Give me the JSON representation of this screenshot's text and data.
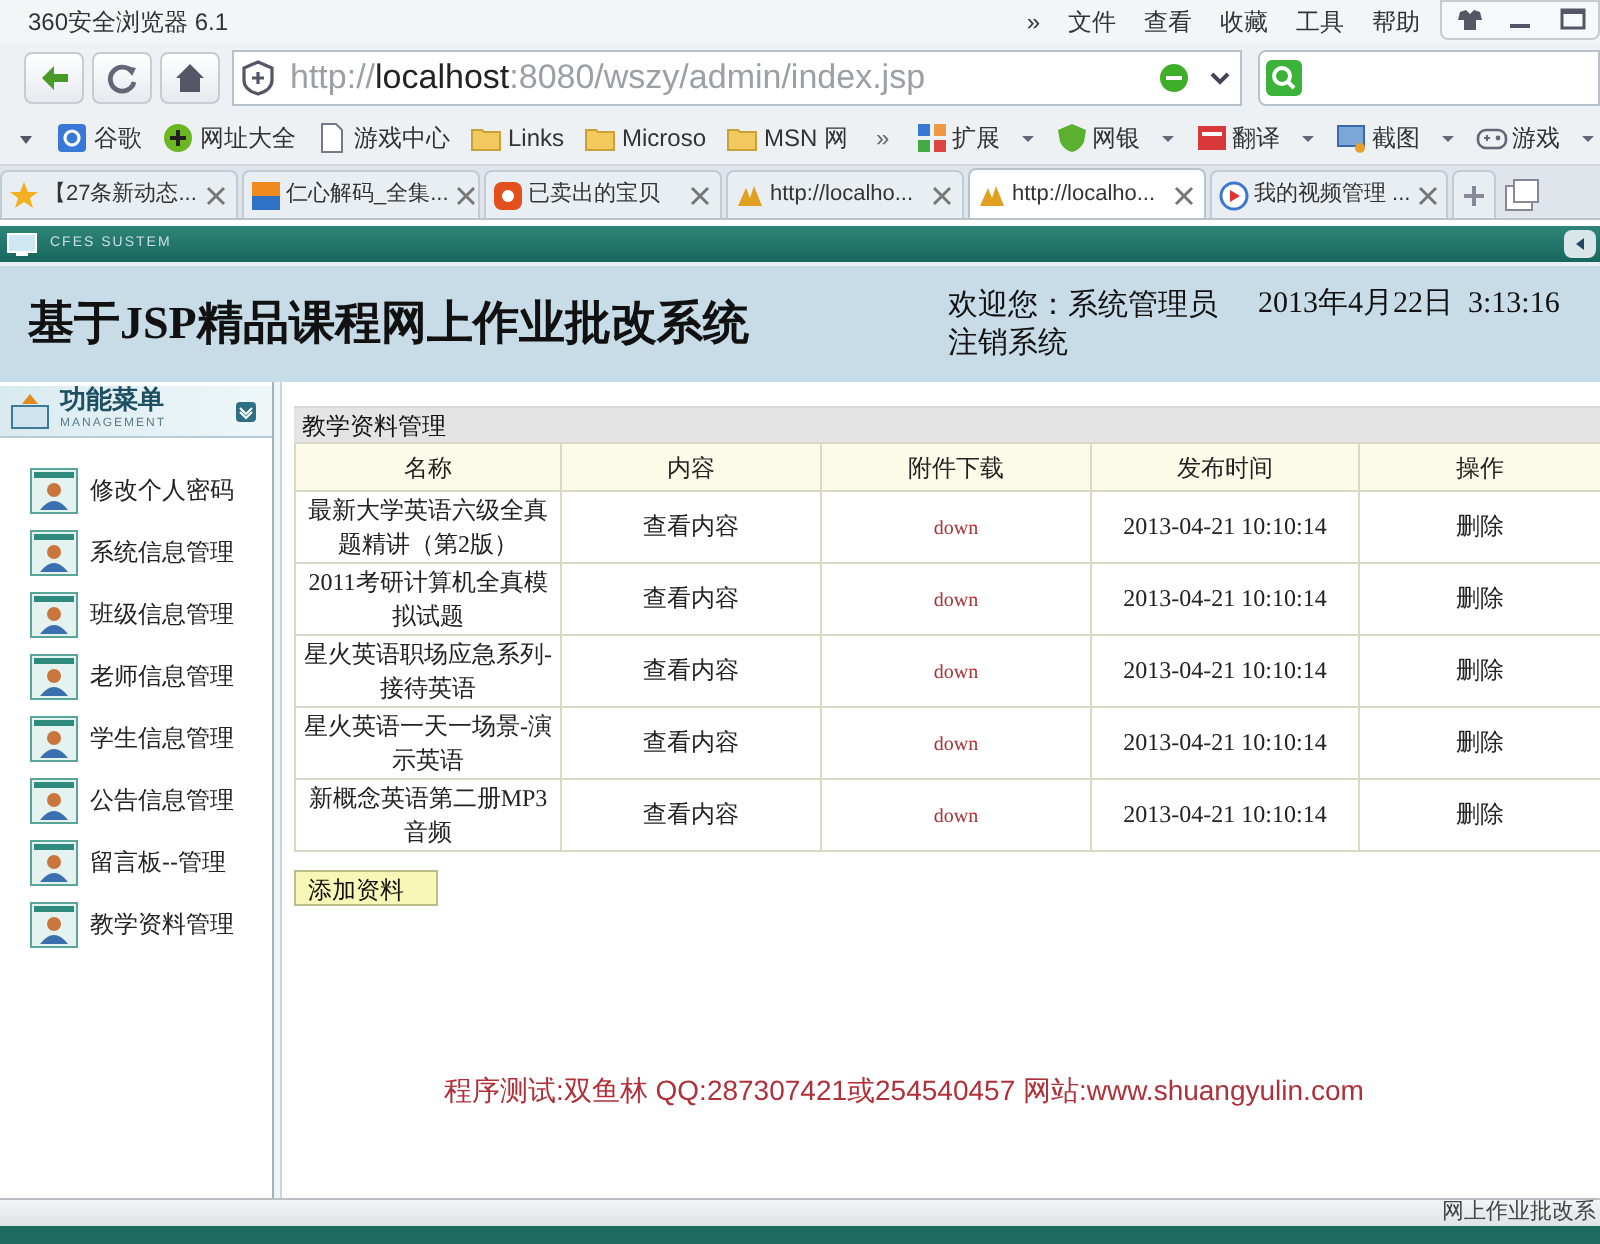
{
  "browser": {
    "title": "360安全浏览器 6.1",
    "menu": [
      "»",
      "文件",
      "查看",
      "收藏",
      "工具",
      "帮助"
    ],
    "url_parts": [
      "http://",
      "localhost",
      ":8080/wszy/admin/index.jsp"
    ],
    "bookmarks": [
      {
        "label": "谷歌",
        "kind": "google"
      },
      {
        "label": "网址大全",
        "kind": "plus"
      },
      {
        "label": "游戏中心",
        "kind": "page"
      },
      {
        "label": "Links",
        "kind": "folder"
      },
      {
        "label": "Microso",
        "kind": "folder"
      },
      {
        "label": "MSN 网",
        "kind": "folder"
      }
    ],
    "more": "»",
    "tools": [
      {
        "label": "扩展",
        "kind": "grid"
      },
      {
        "label": "网银",
        "kind": "shield"
      },
      {
        "label": "翻译",
        "kind": "dictionary"
      },
      {
        "label": "截图",
        "kind": "screen"
      },
      {
        "label": "游戏",
        "kind": "gamepad"
      }
    ],
    "tabs": [
      {
        "label": "【27条新动态...",
        "kind": "star",
        "selected": false
      },
      {
        "label": "仁心解码_全集...",
        "kind": "soku",
        "selected": false
      },
      {
        "label": "已卖出的宝贝",
        "kind": "shop",
        "selected": false
      },
      {
        "label": "http://localho...",
        "kind": "pma",
        "selected": false
      },
      {
        "label": "http://localho...",
        "kind": "pma",
        "selected": true
      },
      {
        "label": "我的视频管理 ...",
        "kind": "play",
        "selected": false
      }
    ]
  },
  "app": {
    "brand": "CFES SUSTEM",
    "title": "基于JSP精品课程网上作业批改系统",
    "welcome": "欢迎您：系统管理员",
    "datetime": "2013年4月22日  3:13:16",
    "logout": "注销系统"
  },
  "sidebar": {
    "title": "功能菜单",
    "subtitle": "MANAGEMENT",
    "items": [
      "修改个人密码",
      "系统信息管理",
      "班级信息管理",
      "老师信息管理",
      "学生信息管理",
      "公告信息管理",
      "留言板--管理",
      "教学资料管理"
    ]
  },
  "panel": {
    "title": "教学资料管理",
    "columns": [
      "名称",
      "内容",
      "附件下载",
      "发布时间",
      "操作"
    ],
    "rows": [
      [
        "最新大学英语六级全真题精讲（第2版）",
        "查看内容",
        "down",
        "2013-04-21 10:10:14",
        "删除"
      ],
      [
        "2011考研计算机全真模拟试题",
        "查看内容",
        "down",
        "2013-04-21 10:10:14",
        "删除"
      ],
      [
        "星火英语职场应急系列-接待英语",
        "查看内容",
        "down",
        "2013-04-21 10:10:14",
        "删除"
      ],
      [
        "星火英语一天一场景-演示英语",
        "查看内容",
        "down",
        "2013-04-21 10:10:14",
        "删除"
      ],
      [
        "新概念英语第二册MP3音频",
        "查看内容",
        "down",
        "2013-04-21 10:10:14",
        "删除"
      ]
    ],
    "add_button": "添加资料"
  },
  "footer": "程序测试:双鱼林 QQ:287307421或254540457 网站:www.shuangyulin.com",
  "status_bar": "网上作业批改系"
}
